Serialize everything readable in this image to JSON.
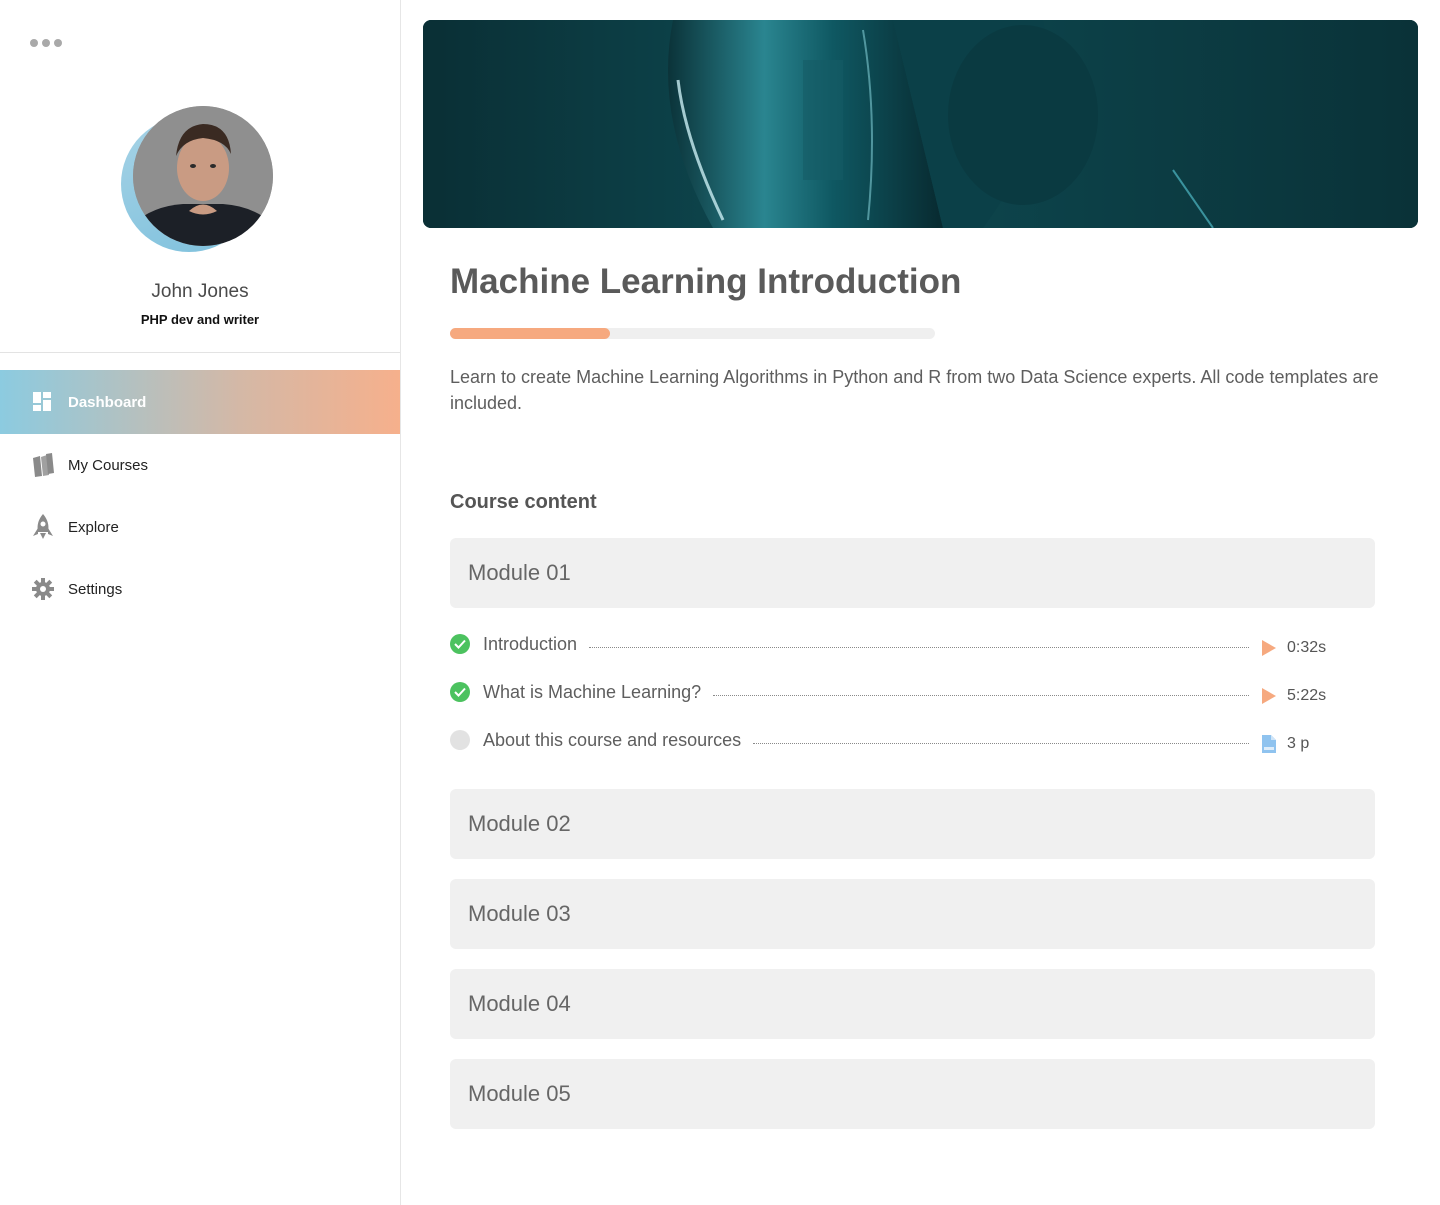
{
  "sidebar": {
    "profile": {
      "name": "John Jones",
      "role": "PHP dev and writer"
    },
    "nav": [
      {
        "label": "Dashboard",
        "icon": "dashboard-icon",
        "active": true
      },
      {
        "label": "My Courses",
        "icon": "books-icon",
        "active": false
      },
      {
        "label": "Explore",
        "icon": "rocket-icon",
        "active": false
      },
      {
        "label": "Settings",
        "icon": "gear-icon",
        "active": false
      }
    ]
  },
  "course": {
    "title": "Machine Learning Introduction",
    "progress": 0.33,
    "description": "Learn to create Machine Learning Algorithms in Python and R from two Data Science experts. All code templates are included.",
    "content_heading": "Course content",
    "modules": [
      {
        "label": "Module 01",
        "lessons": [
          {
            "title": "Introduction",
            "completed": true,
            "type": "video",
            "icon": "play-icon",
            "length": "0:32s"
          },
          {
            "title": "What is Machine Learning?",
            "completed": true,
            "type": "video",
            "icon": "play-icon",
            "length": "5:22s"
          },
          {
            "title": "About this course and resources",
            "completed": false,
            "type": "pdf",
            "icon": "pdf-icon",
            "length": "3 p"
          }
        ]
      },
      {
        "label": "Module 02"
      },
      {
        "label": "Module 03"
      },
      {
        "label": "Module 04"
      },
      {
        "label": "Module 05"
      }
    ]
  },
  "colors": {
    "accent": "#f6a97f",
    "active_gradient_start": "#8ccbe0",
    "active_gradient_end": "#f6b08c",
    "completed": "#4cc25f",
    "banner": "#0b3a40"
  }
}
